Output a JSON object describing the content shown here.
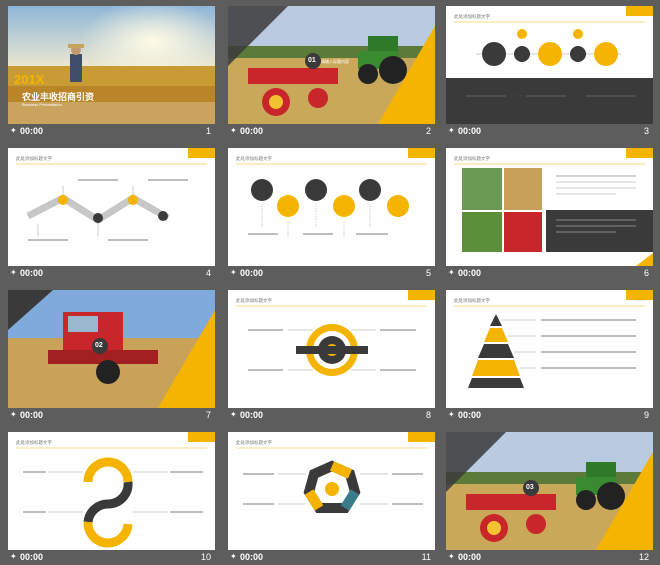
{
  "theme": {
    "accent": "#f4b400",
    "dark": "#3a3a3a",
    "background": "#5d5d5d"
  },
  "slides": [
    {
      "number": "1",
      "time": "00:00",
      "title": "201X",
      "subtitle": "农业丰收招商引资",
      "caption": "Business Presentation"
    },
    {
      "number": "2",
      "time": "00:00",
      "badge": "01",
      "label": "请输入标题内容"
    },
    {
      "number": "3",
      "time": "00:00",
      "header": "此处添加标题文字",
      "icons": [
        "rocket-icon",
        "arrow-icon",
        "person-icon",
        "megaphone-icon"
      ]
    },
    {
      "number": "4",
      "time": "00:00",
      "header": "此处添加标题文字"
    },
    {
      "number": "5",
      "time": "00:00",
      "header": "此处添加标题文字"
    },
    {
      "number": "6",
      "time": "00:00",
      "header": "此处添加标题文字"
    },
    {
      "number": "7",
      "time": "00:00",
      "badge": "02"
    },
    {
      "number": "8",
      "time": "00:00",
      "header": "此处添加标题文字"
    },
    {
      "number": "9",
      "time": "00:00",
      "header": "此处添加标题文字"
    },
    {
      "number": "10",
      "time": "00:00",
      "header": "此处添加标题文字"
    },
    {
      "number": "11",
      "time": "00:00",
      "header": "此处添加标题文字"
    },
    {
      "number": "12",
      "time": "00:00",
      "badge": "03"
    }
  ]
}
